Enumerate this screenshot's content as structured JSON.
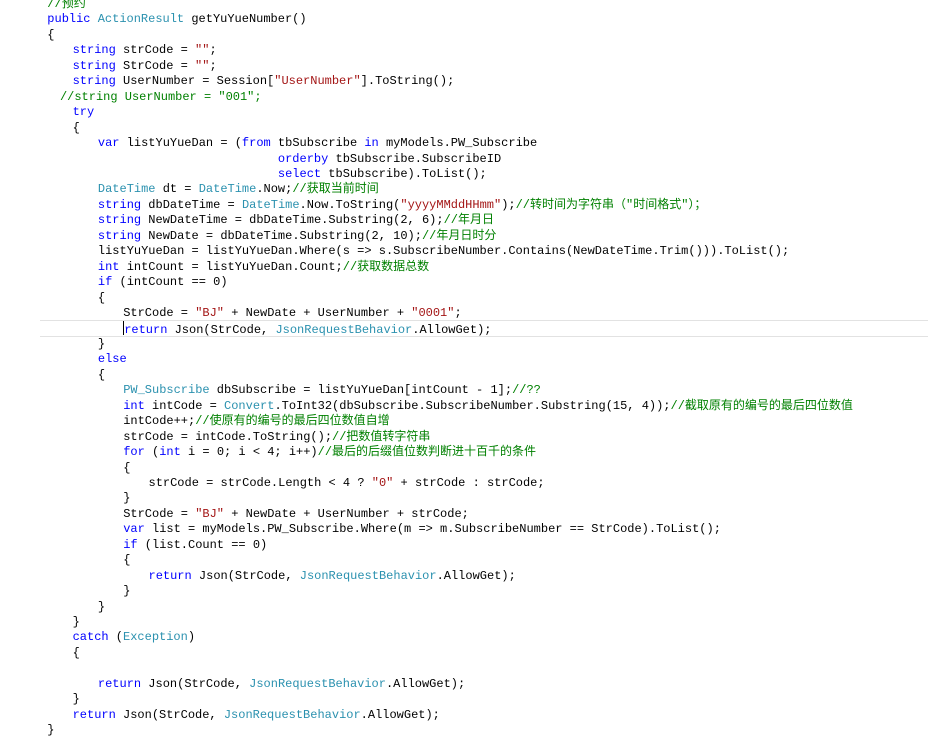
{
  "editor": {
    "theme": {
      "keyword": "#0000ff",
      "type": "#2b91af",
      "string": "#a31515",
      "comment": "#008000",
      "text": "#000000"
    },
    "lines": [
      {
        "indent": 1,
        "tokens": [
          [
            "cm",
            "//预约"
          ]
        ]
      },
      {
        "indent": 1,
        "tokens": [
          [
            "kw",
            "public"
          ],
          [
            "p",
            " "
          ],
          [
            "type",
            "ActionResult"
          ],
          [
            "p",
            " getYuYueNumber()"
          ]
        ]
      },
      {
        "indent": 1,
        "tokens": [
          [
            "p",
            "{"
          ]
        ]
      },
      {
        "indent": 2,
        "tokens": [
          [
            "kw",
            "string"
          ],
          [
            "p",
            " strCode = "
          ],
          [
            "str",
            "\"\""
          ],
          [
            "p",
            ";"
          ]
        ]
      },
      {
        "indent": 2,
        "tokens": [
          [
            "kw",
            "string"
          ],
          [
            "p",
            " StrCode = "
          ],
          [
            "str",
            "\"\""
          ],
          [
            "p",
            ";"
          ]
        ]
      },
      {
        "indent": 2,
        "tokens": [
          [
            "kw",
            "string"
          ],
          [
            "p",
            " UserNumber = Session["
          ],
          [
            "str",
            "\"UserNumber\""
          ],
          [
            "p",
            "].ToString();"
          ]
        ]
      },
      {
        "indent": 1.5,
        "tokens": [
          [
            "cm",
            "//string UserNumber = \"001\";"
          ]
        ]
      },
      {
        "indent": 2,
        "tokens": [
          [
            "kw",
            "try"
          ]
        ]
      },
      {
        "indent": 2,
        "tokens": [
          [
            "p",
            "{"
          ]
        ]
      },
      {
        "indent": 3,
        "tokens": [
          [
            "kw",
            "var"
          ],
          [
            "p",
            " listYuYueDan = ("
          ],
          [
            "kw",
            "from"
          ],
          [
            "p",
            " tbSubscribe "
          ],
          [
            "kw",
            "in"
          ],
          [
            "p",
            " myModels.PW_Subscribe"
          ]
        ]
      },
      {
        "indent": 3,
        "pad": 25,
        "tokens": [
          [
            "kw",
            "orderby"
          ],
          [
            "p",
            " tbSubscribe.SubscribeID"
          ]
        ]
      },
      {
        "indent": 3,
        "pad": 25,
        "tokens": [
          [
            "kw",
            "select"
          ],
          [
            "p",
            " tbSubscribe).ToList();"
          ]
        ]
      },
      {
        "indent": 3,
        "tokens": [
          [
            "type",
            "DateTime"
          ],
          [
            "p",
            " dt = "
          ],
          [
            "type",
            "DateTime"
          ],
          [
            "p",
            ".Now;"
          ],
          [
            "cm",
            "//获取当前时间"
          ]
        ]
      },
      {
        "indent": 3,
        "tokens": [
          [
            "kw",
            "string"
          ],
          [
            "p",
            " dbDateTime = "
          ],
          [
            "type",
            "DateTime"
          ],
          [
            "p",
            ".Now.ToString("
          ],
          [
            "str",
            "\"yyyyMMddHHmm\""
          ],
          [
            "p",
            ");"
          ],
          [
            "cm",
            "//转时间为字符串（\"时间格式\"）；"
          ]
        ]
      },
      {
        "indent": 3,
        "tokens": [
          [
            "kw",
            "string"
          ],
          [
            "p",
            " NewDateTime = dbDateTime.Substring(2, 6);"
          ],
          [
            "cm",
            "//年月日"
          ]
        ]
      },
      {
        "indent": 3,
        "tokens": [
          [
            "kw",
            "string"
          ],
          [
            "p",
            " NewDate = dbDateTime.Substring(2, 10);"
          ],
          [
            "cm",
            "//年月日时分"
          ]
        ]
      },
      {
        "indent": 3,
        "tokens": [
          [
            "p",
            "listYuYueDan = listYuYueDan.Where(s => s.SubscribeNumber.Contains(NewDateTime.Trim())).ToList();"
          ]
        ]
      },
      {
        "indent": 3,
        "tokens": [
          [
            "kw",
            "int"
          ],
          [
            "p",
            " intCount = listYuYueDan.Count;"
          ],
          [
            "cm",
            "//获取数据总数"
          ]
        ]
      },
      {
        "indent": 3,
        "tokens": [
          [
            "kw",
            "if"
          ],
          [
            "p",
            " (intCount == 0)"
          ]
        ]
      },
      {
        "indent": 3,
        "tokens": [
          [
            "p",
            "{"
          ]
        ]
      },
      {
        "indent": 4,
        "tokens": [
          [
            "p",
            "StrCode = "
          ],
          [
            "str",
            "\"BJ\""
          ],
          [
            "p",
            " + NewDate + UserNumber + "
          ],
          [
            "str",
            "\"0001\""
          ],
          [
            "p",
            ";"
          ]
        ]
      },
      {
        "indent": 4,
        "highlight": true,
        "caret": true,
        "tokens": [
          [
            "kw",
            "return"
          ],
          [
            "p",
            " Json(StrCode, "
          ],
          [
            "type",
            "JsonRequestBehavior"
          ],
          [
            "p",
            ".AllowGet);"
          ]
        ]
      },
      {
        "indent": 3,
        "tokens": [
          [
            "p",
            "}"
          ]
        ]
      },
      {
        "indent": 3,
        "tokens": [
          [
            "kw",
            "else"
          ]
        ]
      },
      {
        "indent": 3,
        "tokens": [
          [
            "p",
            "{"
          ]
        ]
      },
      {
        "indent": 4,
        "tokens": [
          [
            "type",
            "PW_Subscribe"
          ],
          [
            "p",
            " dbSubscribe = listYuYueDan[intCount - 1];"
          ],
          [
            "cm",
            "//??"
          ]
        ]
      },
      {
        "indent": 4,
        "tokens": [
          [
            "kw",
            "int"
          ],
          [
            "p",
            " intCode = "
          ],
          [
            "type",
            "Convert"
          ],
          [
            "p",
            ".ToInt32(dbSubscribe.SubscribeNumber.Substring(15, 4));"
          ],
          [
            "cm",
            "//截取原有的编号的最后四位数值"
          ]
        ]
      },
      {
        "indent": 4,
        "tokens": [
          [
            "p",
            "intCode++;"
          ],
          [
            "cm",
            "//使原有的编号的最后四位数值自增"
          ]
        ]
      },
      {
        "indent": 4,
        "tokens": [
          [
            "p",
            "strCode = intCode.ToString();"
          ],
          [
            "cm",
            "//把数值转字符串"
          ]
        ]
      },
      {
        "indent": 4,
        "tokens": [
          [
            "kw",
            "for"
          ],
          [
            "p",
            " ("
          ],
          [
            "kw",
            "int"
          ],
          [
            "p",
            " i = 0; i < 4; i++)"
          ],
          [
            "cm",
            "//最后的后缀值位数判断进十百千的条件"
          ]
        ]
      },
      {
        "indent": 4,
        "tokens": [
          [
            "p",
            "{"
          ]
        ]
      },
      {
        "indent": 5,
        "tokens": [
          [
            "p",
            "strCode = strCode.Length < 4 ? "
          ],
          [
            "str",
            "\"0\""
          ],
          [
            "p",
            " + strCode : strCode;"
          ]
        ]
      },
      {
        "indent": 4,
        "tokens": [
          [
            "p",
            "}"
          ]
        ]
      },
      {
        "indent": 4,
        "tokens": [
          [
            "p",
            "StrCode = "
          ],
          [
            "str",
            "\"BJ\""
          ],
          [
            "p",
            " + NewDate + UserNumber + strCode;"
          ]
        ]
      },
      {
        "indent": 4,
        "tokens": [
          [
            "kw",
            "var"
          ],
          [
            "p",
            " list = myModels.PW_Subscribe.Where(m => m.SubscribeNumber == StrCode).ToList();"
          ]
        ]
      },
      {
        "indent": 4,
        "tokens": [
          [
            "kw",
            "if"
          ],
          [
            "p",
            " (list.Count == 0)"
          ]
        ]
      },
      {
        "indent": 4,
        "tokens": [
          [
            "p",
            "{"
          ]
        ]
      },
      {
        "indent": 5,
        "tokens": [
          [
            "kw",
            "return"
          ],
          [
            "p",
            " Json(StrCode, "
          ],
          [
            "type",
            "JsonRequestBehavior"
          ],
          [
            "p",
            ".AllowGet);"
          ]
        ]
      },
      {
        "indent": 4,
        "tokens": [
          [
            "p",
            "}"
          ]
        ]
      },
      {
        "indent": 3,
        "tokens": [
          [
            "p",
            "}"
          ]
        ]
      },
      {
        "indent": 2,
        "tokens": [
          [
            "p",
            "}"
          ]
        ]
      },
      {
        "indent": 2,
        "tokens": [
          [
            "kw",
            "catch"
          ],
          [
            "p",
            " ("
          ],
          [
            "type",
            "Exception"
          ],
          [
            "p",
            ")"
          ]
        ]
      },
      {
        "indent": 2,
        "tokens": [
          [
            "p",
            "{"
          ]
        ]
      },
      {
        "indent": 2,
        "tokens": []
      },
      {
        "indent": 3,
        "tokens": [
          [
            "kw",
            "return"
          ],
          [
            "p",
            " Json(StrCode, "
          ],
          [
            "type",
            "JsonRequestBehavior"
          ],
          [
            "p",
            ".AllowGet);"
          ]
        ]
      },
      {
        "indent": 2,
        "tokens": [
          [
            "p",
            "}"
          ]
        ]
      },
      {
        "indent": 2,
        "tokens": [
          [
            "kw",
            "return"
          ],
          [
            "p",
            " Json(StrCode, "
          ],
          [
            "type",
            "JsonRequestBehavior"
          ],
          [
            "p",
            ".AllowGet);"
          ]
        ]
      },
      {
        "indent": 1,
        "tokens": [
          [
            "p",
            "}"
          ]
        ]
      }
    ]
  }
}
